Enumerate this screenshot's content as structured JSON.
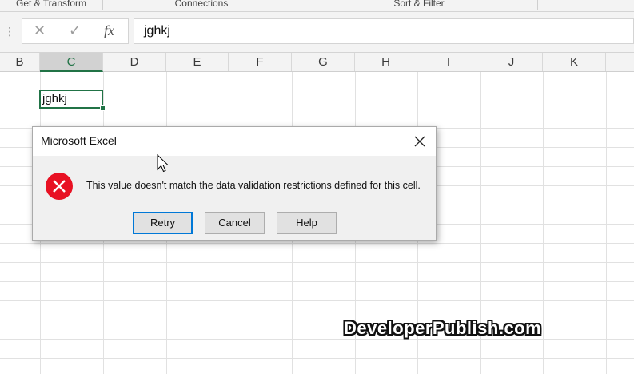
{
  "ribbon": {
    "groups": [
      "Get & Transform",
      "Connections",
      "Sort & Filter"
    ]
  },
  "formula_bar": {
    "cancel_icon": "✕",
    "enter_icon": "✓",
    "fx_label": "fx",
    "value": "jghkj"
  },
  "columns": [
    "B",
    "C",
    "D",
    "E",
    "F",
    "G",
    "H",
    "I",
    "J",
    "K"
  ],
  "selected_column": "C",
  "active_cell": {
    "value": "jghkj"
  },
  "dialog": {
    "title": "Microsoft Excel",
    "message": "This value doesn't match the data validation restrictions defined for this cell.",
    "buttons": {
      "retry": "Retry",
      "cancel": "Cancel",
      "help": "Help"
    },
    "icon": "error-x-icon"
  },
  "watermark": "DeveloperPublish.com",
  "colors": {
    "excel_green": "#217346",
    "error_red": "#e81123",
    "focus_blue": "#0078d7"
  }
}
